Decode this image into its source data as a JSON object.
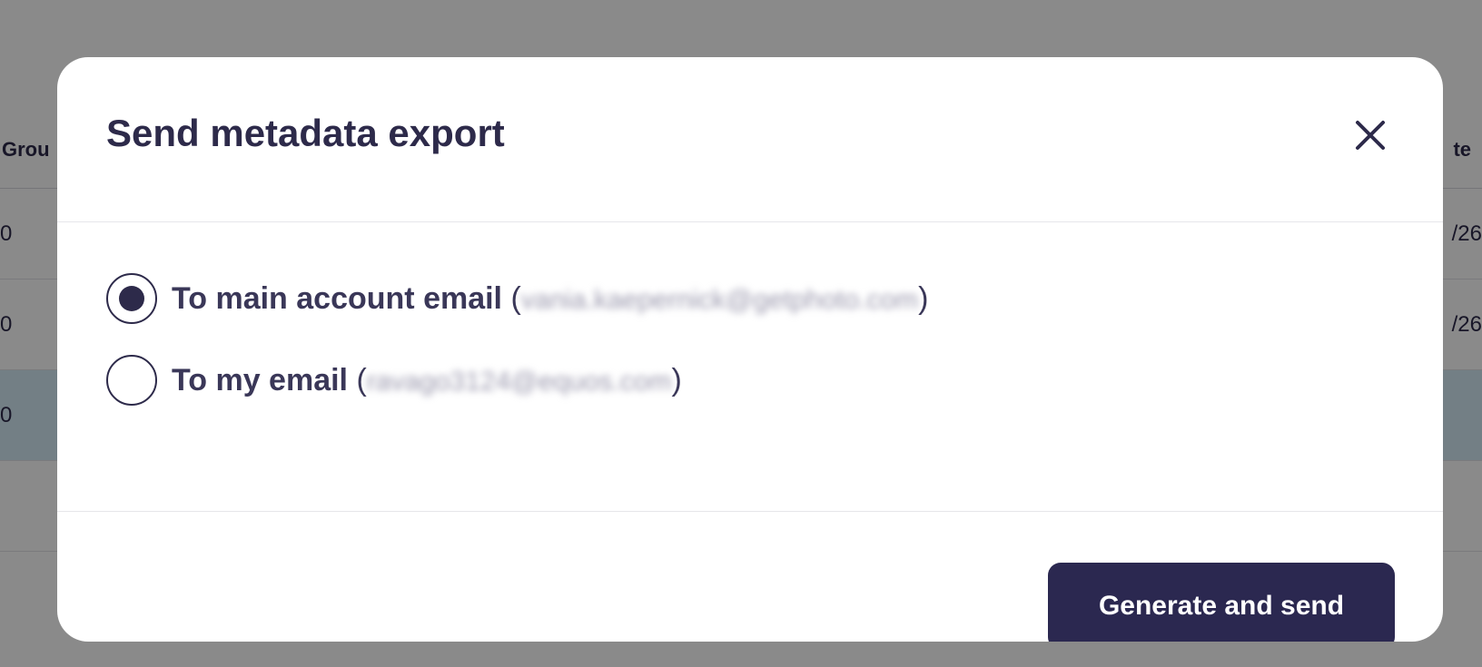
{
  "background": {
    "header_left": "Grou",
    "header_right": "te",
    "rows": [
      {
        "left": "0",
        "right": "/26"
      },
      {
        "left": "0",
        "right": "/26"
      },
      {
        "left": "0",
        "right": ""
      }
    ]
  },
  "modal": {
    "title": "Send metadata export",
    "options": [
      {
        "label": "To main account email",
        "email": "vania.kaepernick@getphoto.com",
        "selected": true
      },
      {
        "label": "To my email",
        "email": "ravago3124@equos.com",
        "selected": false
      }
    ],
    "submit_label": "Generate and send",
    "icons": {
      "close": "close-icon"
    }
  },
  "colors": {
    "primary": "#2b2850",
    "text": "#2d2a4a",
    "overlay": "rgba(0,0,0,0.46)"
  }
}
